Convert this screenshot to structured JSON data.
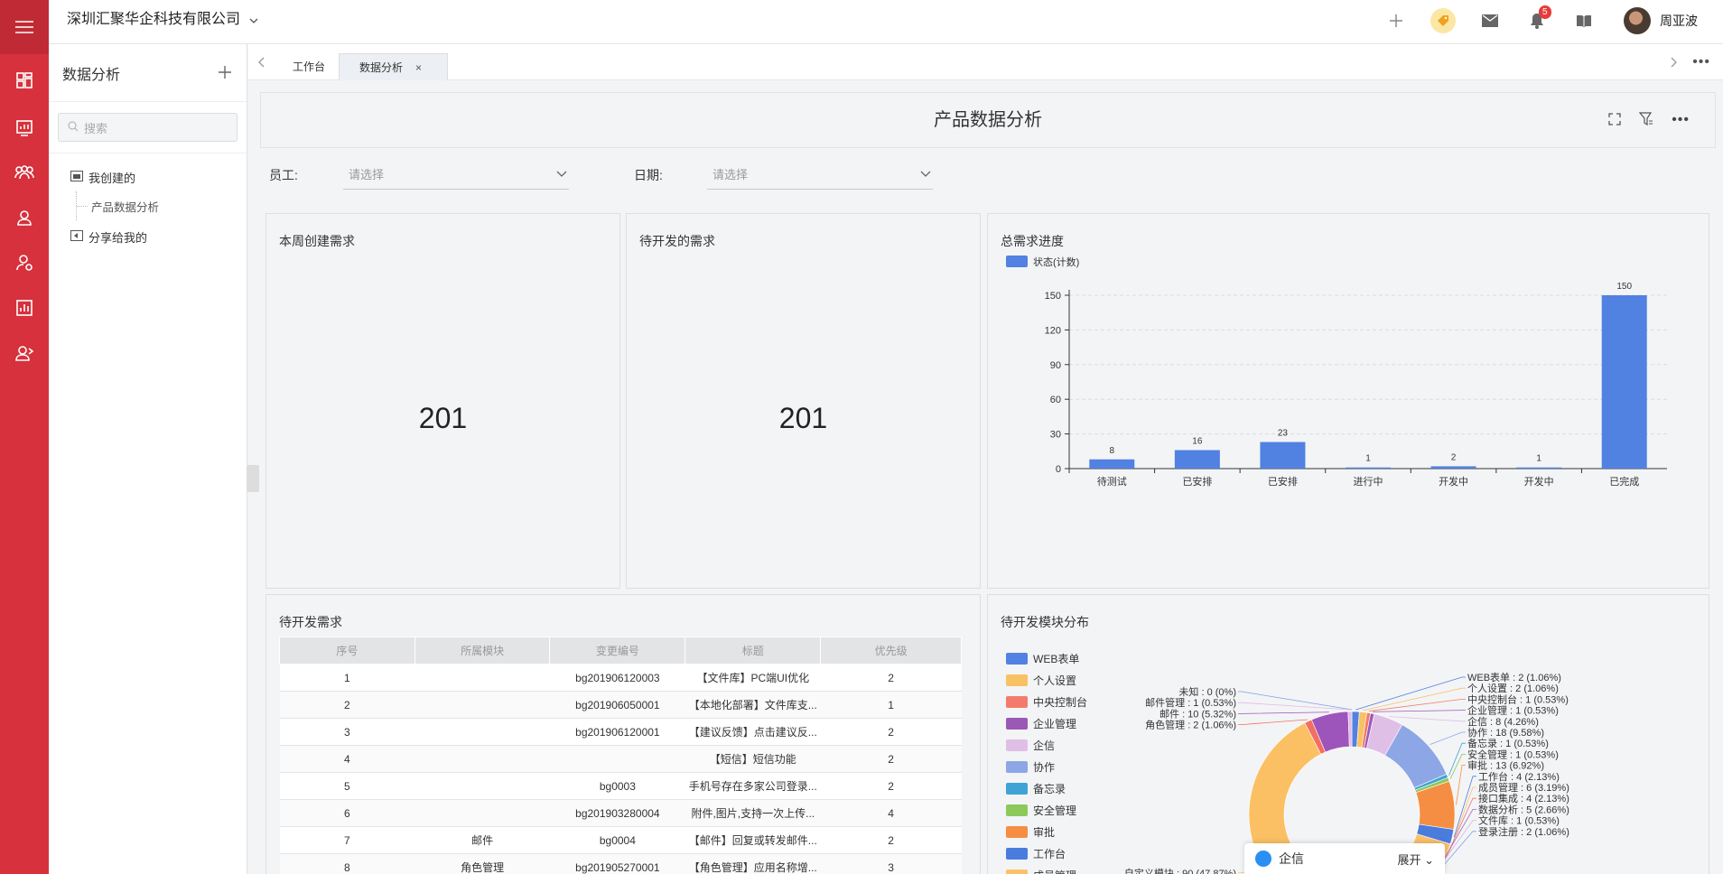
{
  "header": {
    "company": "深圳汇聚华企科技有限公司",
    "notification_count": "5",
    "user_name": "周亚波"
  },
  "sidebar": {
    "title": "数据分析",
    "search_placeholder": "搜索",
    "tree": {
      "my_created": "我创建的",
      "child": "产品数据分析",
      "shared": "分享给我的"
    }
  },
  "tabs": {
    "workbench": "工作台",
    "analytics": "数据分析"
  },
  "page": {
    "title": "产品数据分析",
    "filters": {
      "employee_label": "员工:",
      "employee_placeholder": "请选择",
      "date_label": "日期:",
      "date_placeholder": "请选择"
    }
  },
  "cards": {
    "weekly": {
      "title": "本周创建需求",
      "value": "201"
    },
    "pending": {
      "title": "待开发的需求",
      "value": "201"
    },
    "progress": {
      "title": "总需求进度"
    },
    "table": {
      "title": "待开发需求"
    },
    "modules": {
      "title": "待开发模块分布"
    }
  },
  "table": {
    "columns": [
      "序号",
      "所属模块",
      "变更编号",
      "标题",
      "优先级"
    ],
    "rows": [
      [
        "1",
        "",
        "bg201906120003",
        "【文件库】PC端UI优化",
        "2"
      ],
      [
        "2",
        "",
        "bg201906050001",
        "【本地化部署】文件库支...",
        "1"
      ],
      [
        "3",
        "",
        "bg201906120001",
        "【建议反馈】点击建议反...",
        "2"
      ],
      [
        "4",
        "",
        "",
        "【短信】短信功能",
        "2"
      ],
      [
        "5",
        "",
        "bg0003",
        "手机号存在多家公司登录...",
        "2"
      ],
      [
        "6",
        "",
        "bg201903280004",
        "附件,图片,支持一次上传...",
        "4"
      ],
      [
        "7",
        "邮件",
        "bg0004",
        "【邮件】回复或转发邮件...",
        "2"
      ],
      [
        "8",
        "角色管理",
        "bg201905270001",
        "【角色管理】应用名称增...",
        "3"
      ]
    ]
  },
  "chart_data": [
    {
      "type": "bar",
      "title": "总需求进度",
      "legend": "状态(计数)",
      "categories": [
        "待测试",
        "已安排",
        "已安排",
        "进行中",
        "开发中",
        "开发中",
        "已完成"
      ],
      "series": [
        {
          "name": "状态(计数)",
          "values": [
            8,
            16,
            23,
            1,
            2,
            1,
            150
          ]
        }
      ],
      "ylim": [
        0,
        150
      ],
      "yticks": [
        0,
        30,
        60,
        90,
        120,
        150
      ],
      "grid": true,
      "legend_position": "top-left",
      "color": "#5181e1"
    },
    {
      "type": "pie",
      "title": "待开发模块分布",
      "legend_entries": [
        "WEB表单",
        "个人设置",
        "中央控制台",
        "企业管理",
        "企信",
        "协作",
        "备忘录",
        "安全管理",
        "审批",
        "工作台",
        "成员管理"
      ],
      "legend_colors": [
        "#5181e1",
        "#f8c163",
        "#f47b6b",
        "#9b59b6",
        "#e0bfe6",
        "#8da6e6",
        "#3fa3d6",
        "#8cc95a",
        "#f58e42",
        "#4a7cde",
        "#fbc16a"
      ],
      "slices": [
        {
          "label": "WEB表单",
          "value": 2,
          "pct": "1.06%",
          "text": "WEB表单 : 2 (1.06%)",
          "color": "#5181e1"
        },
        {
          "label": "个人设置",
          "value": 2,
          "pct": "1.06%",
          "text": "个人设置 : 2 (1.06%)",
          "color": "#f8c163"
        },
        {
          "label": "中央控制台",
          "value": 1,
          "pct": "0.53%",
          "text": "中央控制台 : 1 (0.53%)",
          "color": "#f47b6b"
        },
        {
          "label": "企业管理",
          "value": 1,
          "pct": "0.53%",
          "text": "企业管理 : 1 (0.53%)",
          "color": "#9b59b6"
        },
        {
          "label": "企信",
          "value": 8,
          "pct": "4.26%",
          "text": "企信 : 8 (4.26%)",
          "color": "#e0bfe6"
        },
        {
          "label": "协作",
          "value": 18,
          "pct": "9.58%",
          "text": "协作 : 18 (9.58%)",
          "color": "#8da6e6"
        },
        {
          "label": "备忘录",
          "value": 1,
          "pct": "0.53%",
          "text": "备忘录 : 1 (0.53%)",
          "color": "#3fa3d6"
        },
        {
          "label": "安全管理",
          "value": 1,
          "pct": "0.53%",
          "text": "安全管理 : 1 (0.53%)",
          "color": "#8cc95a"
        },
        {
          "label": "审批",
          "value": 13,
          "pct": "6.92%",
          "text": "审批 : 13 (6.92%)",
          "color": "#f58e42"
        },
        {
          "label": "工作台",
          "value": 4,
          "pct": "2.13%",
          "text": "工作台 : 4 (2.13%)",
          "color": "#4a7cde"
        },
        {
          "label": "成员管理",
          "value": 6,
          "pct": "3.19%",
          "text": "成员管理 : 6 (3.19%)",
          "color": "#fbc16a"
        },
        {
          "label": "接口集成",
          "value": 4,
          "pct": "2.13%",
          "text": "接口集成 : 4 (2.13%)",
          "color": "#f27769"
        },
        {
          "label": "数据分析",
          "value": 5,
          "pct": "2.66%",
          "text": "数据分析 : 5 (2.66%)",
          "color": "#a663c7"
        },
        {
          "label": "文件库",
          "value": 1,
          "pct": "0.53%",
          "text": "文件库 : 1 (0.53%)",
          "color": "#d8b6e3"
        },
        {
          "label": "登录注册",
          "value": 2,
          "pct": "1.06%",
          "text": "登录注册 : 2 (1.06%)",
          "color": "#7f9ee8"
        },
        {
          "label": "自定义模块",
          "value": 90,
          "pct": "47.87%",
          "text": "自定义模块 : 90 (47.87%)",
          "color": "#fbc063"
        },
        {
          "label": "角色管理",
          "value": 2,
          "pct": "1.06%",
          "text": "角色管理 : 2 (1.06%)",
          "color": "#f36f62"
        },
        {
          "label": "邮件",
          "value": 10,
          "pct": "5.32%",
          "text": "邮件 : 10 (5.32%)",
          "color": "#9d55bb"
        },
        {
          "label": "邮件管理",
          "value": 1,
          "pct": "0.53%",
          "text": "邮件管理 : 1 (0.53%)",
          "color": "#e5b8e8"
        },
        {
          "label": "未知",
          "value": 0,
          "pct": "0%",
          "text": "未知 : 0 (0%)",
          "color": "#7e9ee4"
        }
      ]
    }
  ],
  "chat": {
    "label": "企信",
    "expand": "展开"
  }
}
